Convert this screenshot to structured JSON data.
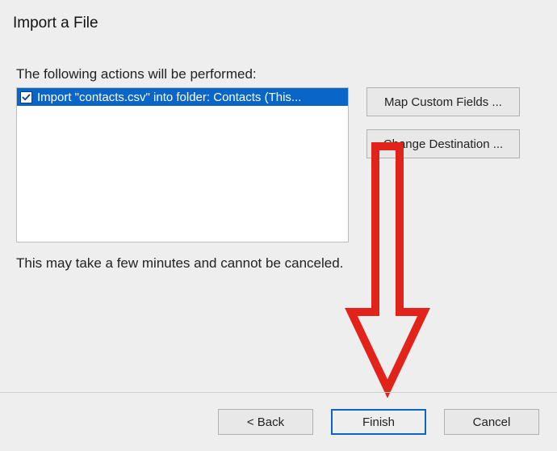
{
  "dialog": {
    "title": "Import a File",
    "instructions": "The following actions will be performed:",
    "actions": [
      {
        "label": "Import \"contacts.csv\" into folder: Contacts (This...",
        "checked": true
      }
    ],
    "warning": "This may take a few minutes and cannot be canceled."
  },
  "side_buttons": {
    "map_fields": "Map Custom Fields ...",
    "change_destination": "Change Destination ..."
  },
  "footer": {
    "back": "< Back",
    "finish": "Finish",
    "cancel": "Cancel"
  }
}
